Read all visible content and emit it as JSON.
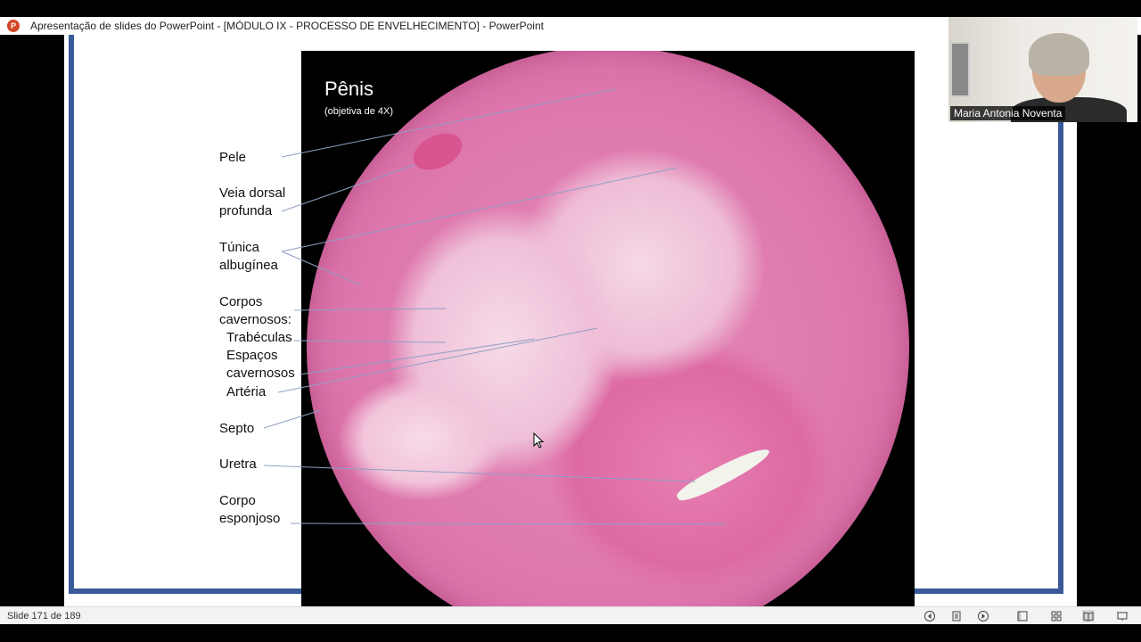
{
  "window": {
    "title": "Apresentação de slides do PowerPoint - [MÓDULO IX - PROCESSO DE ENVELHECIMENTO] - PowerPoint",
    "app_icon": "powerpoint-icon",
    "app_icon_letter": "P"
  },
  "slide": {
    "image_title": "Pênis",
    "image_subtitle": "(objetiva de 4X)",
    "labels": {
      "pele": "Pele",
      "veia1": "Veia dorsal",
      "veia2": "profunda",
      "tunica1": "Túnica",
      "tunica2": "albugínea",
      "corpos1": "Corpos",
      "corpos2": "cavernosos:",
      "trabeculas": "Trabéculas",
      "espacos1": "Espaços",
      "espacos2": "cavernosos",
      "arteria": "Artéria",
      "septo": "Septo",
      "uretra": "Uretra",
      "corpo1": "Corpo",
      "corpo2": "esponjoso"
    },
    "frame_color": "#3a5a98"
  },
  "webcam": {
    "participant_name": "Maria Antonia Noventa"
  },
  "statusbar": {
    "slide_counter": "Slide 171 de 189",
    "icons": [
      "previous-icon",
      "notes-icon",
      "next-icon",
      "normal-view-icon",
      "slide-sorter-icon",
      "reading-view-icon",
      "slideshow-icon"
    ]
  }
}
